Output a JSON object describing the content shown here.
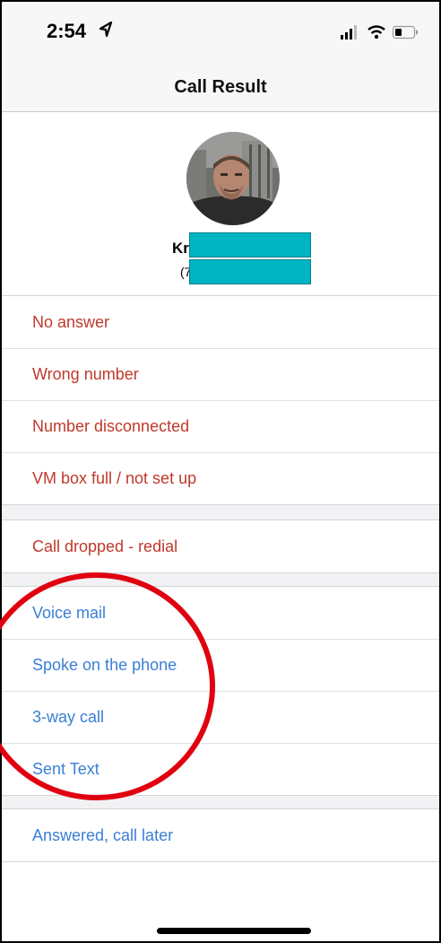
{
  "status_bar": {
    "time": "2:54",
    "icons": [
      "location-arrow-icon",
      "cellular-signal-icon",
      "wifi-icon",
      "battery-icon"
    ]
  },
  "nav": {
    "title": "Call Result"
  },
  "contact": {
    "name_visible": "Kr",
    "phone_visible": "(7"
  },
  "groups": [
    {
      "color": "#c0392b",
      "items": [
        "No answer",
        "Wrong number",
        "Number disconnected",
        "VM box full / not set up"
      ]
    },
    {
      "color": "#c0392b",
      "items": [
        "Call dropped - redial"
      ]
    },
    {
      "color": "#3a7fd5",
      "items": [
        "Voice mail",
        "Spoke on the phone",
        "3-way call",
        "Sent Text"
      ]
    },
    {
      "color": "#3a7fd5",
      "items": [
        "Answered, call later"
      ]
    }
  ],
  "colors": {
    "negative_result": "#c0392b",
    "positive_result": "#3a7fd5",
    "redaction": "#00b5c2",
    "annotation": "#e0000f"
  }
}
